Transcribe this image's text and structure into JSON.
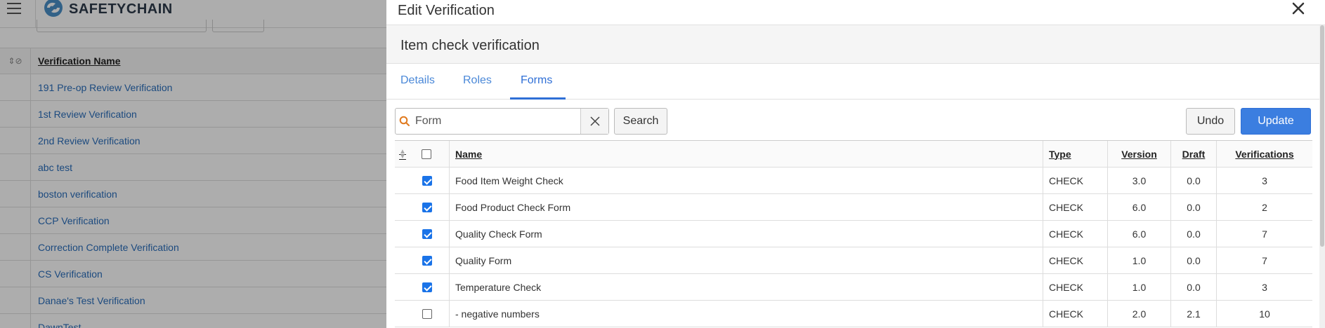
{
  "app": {
    "brand_prefix": "SAFETY",
    "brand_suffix": "CHAIN",
    "list_header": "Verification Name",
    "list_items": [
      "191 Pre-op Review Verification",
      "1st Review Verification",
      "2nd Review Verification",
      "abc test",
      "boston verification",
      "CCP Verification",
      "Correction Complete Verification",
      "CS Verification",
      "Danae's Test Verification",
      "DawnTest"
    ]
  },
  "dialog": {
    "title": "Edit Verification",
    "subtitle": "Item check verification",
    "tabs": [
      {
        "label": "Details",
        "active": false
      },
      {
        "label": "Roles",
        "active": false
      },
      {
        "label": "Forms",
        "active": true
      }
    ],
    "search": {
      "value": "Form",
      "button_label": "Search"
    },
    "undo_label": "Undo",
    "update_label": "Update",
    "columns": {
      "name": "Name",
      "type": "Type",
      "version": "Version",
      "draft": "Draft",
      "verifications": "Verifications"
    },
    "rows": [
      {
        "checked": true,
        "name": "Food Item Weight Check",
        "type": "CHECK",
        "version": "3.0",
        "draft": "0.0",
        "verifications": "3"
      },
      {
        "checked": true,
        "name": "Food Product Check Form",
        "type": "CHECK",
        "version": "6.0",
        "draft": "0.0",
        "verifications": "2"
      },
      {
        "checked": true,
        "name": "Quality Check Form",
        "type": "CHECK",
        "version": "6.0",
        "draft": "0.0",
        "verifications": "7"
      },
      {
        "checked": true,
        "name": "Quality Form",
        "type": "CHECK",
        "version": "1.0",
        "draft": "0.0",
        "verifications": "7"
      },
      {
        "checked": true,
        "name": "Temperature Check",
        "type": "CHECK",
        "version": "1.0",
        "draft": "0.0",
        "verifications": "3"
      },
      {
        "checked": false,
        "name": "- negative numbers",
        "type": "CHECK",
        "version": "2.0",
        "draft": "2.1",
        "verifications": "10"
      }
    ]
  },
  "colors": {
    "accent": "#2f6fd6",
    "button_primary": "#3b7ee0",
    "link": "#2a6ebb",
    "search_icon": "#e07a1f"
  },
  "icons": [
    "hamburger-icon",
    "safetychain-logo",
    "close-icon",
    "search-icon",
    "clear-icon",
    "sort-icon",
    "block-icon"
  ]
}
